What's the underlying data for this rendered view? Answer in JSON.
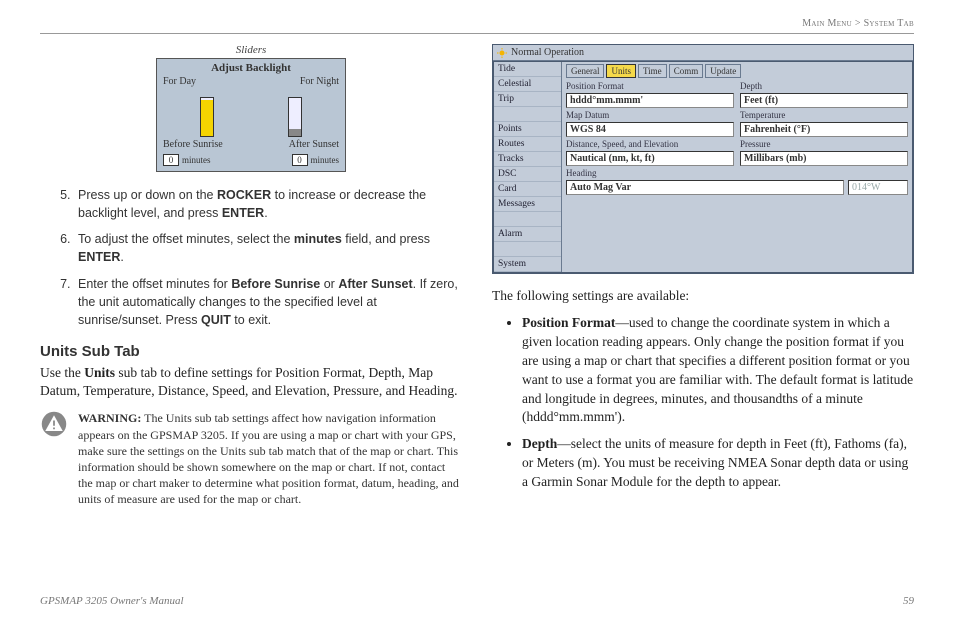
{
  "breadcrumb": {
    "left": "Main Menu",
    "sep": " > ",
    "right": "System Tab"
  },
  "leftCol": {
    "sliderCaption": "Sliders",
    "sliderPanel": {
      "title": "Adjust Backlight",
      "dayLabel": "For Day",
      "nightLabel": "For Night",
      "beforeLabel": "Before Sunrise",
      "afterLabel": "After Sunset",
      "min1": "0",
      "min1lbl": "minutes",
      "min2": "0",
      "min2lbl": "minutes"
    },
    "steps": [
      {
        "pre": "Press up or down on the ",
        "b1": "ROCKER",
        "mid": " to increase or decrease the backlight level, and press ",
        "b2": "ENTER",
        "post": "."
      },
      {
        "pre": "To adjust the offset minutes, select the ",
        "b1": "minutes",
        "mid": " field, and press ",
        "b2": "ENTER",
        "post": "."
      },
      {
        "pre": "Enter the offset minutes for ",
        "b1": "Before Sunrise",
        "mid": " or ",
        "b2": "After Sunset",
        "post2": ". If zero, the unit automatically changes to the specified level at sunrise/sunset. Press ",
        "b3": "QUIT",
        "post3": " to exit."
      }
    ],
    "subhead": "Units Sub Tab",
    "intro": {
      "pre": "Use the ",
      "b": "Units",
      "post": " sub tab to define settings for Position Format, Depth, Map Datum, Temperature, Distance, Speed, and Elevation, Pressure, and Heading."
    },
    "warning": {
      "lead": "WARNING:",
      "text": " The Units sub tab settings affect how navigation information appears on the GPSMAP 3205. If you are using a map or chart with your GPS, make sure the settings on the Units sub tab match that of the map or chart. This information should be shown somewhere on the map or chart. If not, contact the map or chart maker to determine what position format, datum, heading, and units of measure are used for the map or chart."
    }
  },
  "rightCol": {
    "unitsHead": "Normal Operation",
    "leftMenu": [
      "Tide",
      "Celestial",
      "Trip",
      "",
      "Points",
      "Routes",
      "Tracks",
      "DSC",
      "Card",
      "Messages",
      "",
      "Alarm",
      "",
      "System"
    ],
    "leftMenuDim": [
      3,
      10,
      12
    ],
    "tabs": [
      "General",
      "Units",
      "Time",
      "Comm",
      "Update"
    ],
    "activeTab": 1,
    "fields": {
      "posfmt_lbl": "Position Format",
      "posfmt_val": "hddd°mm.mmm'",
      "depth_lbl": "Depth",
      "depth_val": "Feet (ft)",
      "datum_lbl": "Map Datum",
      "datum_val": "WGS 84",
      "temp_lbl": "Temperature",
      "temp_val": "Fahrenheit (°F)",
      "dse_lbl": "Distance, Speed, and Elevation",
      "dse_val": "Nautical (nm, kt, ft)",
      "press_lbl": "Pressure",
      "press_val": "Millibars (mb)",
      "head_lbl": "Heading",
      "head_val": "Auto Mag Var",
      "head_val2": "014°W"
    },
    "following": "The following settings are available:",
    "bullets": [
      {
        "b": "Position Format",
        "text": "—used to change the coordinate system in which a given location reading appears. Only change the position format if you are using a map or chart that specifies a different position format or you want to use a format you are familiar with. The default format is latitude and longitude in degrees, minutes, and thousandths of a minute (hddd°mm.mmm')."
      },
      {
        "b": "Depth",
        "text": "—select the units of measure for depth in Feet (ft), Fathoms (fa), or Meters (m). You must be receiving NMEA Sonar depth data or using a Garmin Sonar Module for the depth to appear."
      }
    ]
  },
  "footer": {
    "left": "GPSMAP 3205 Owner's Manual",
    "right": "59"
  }
}
